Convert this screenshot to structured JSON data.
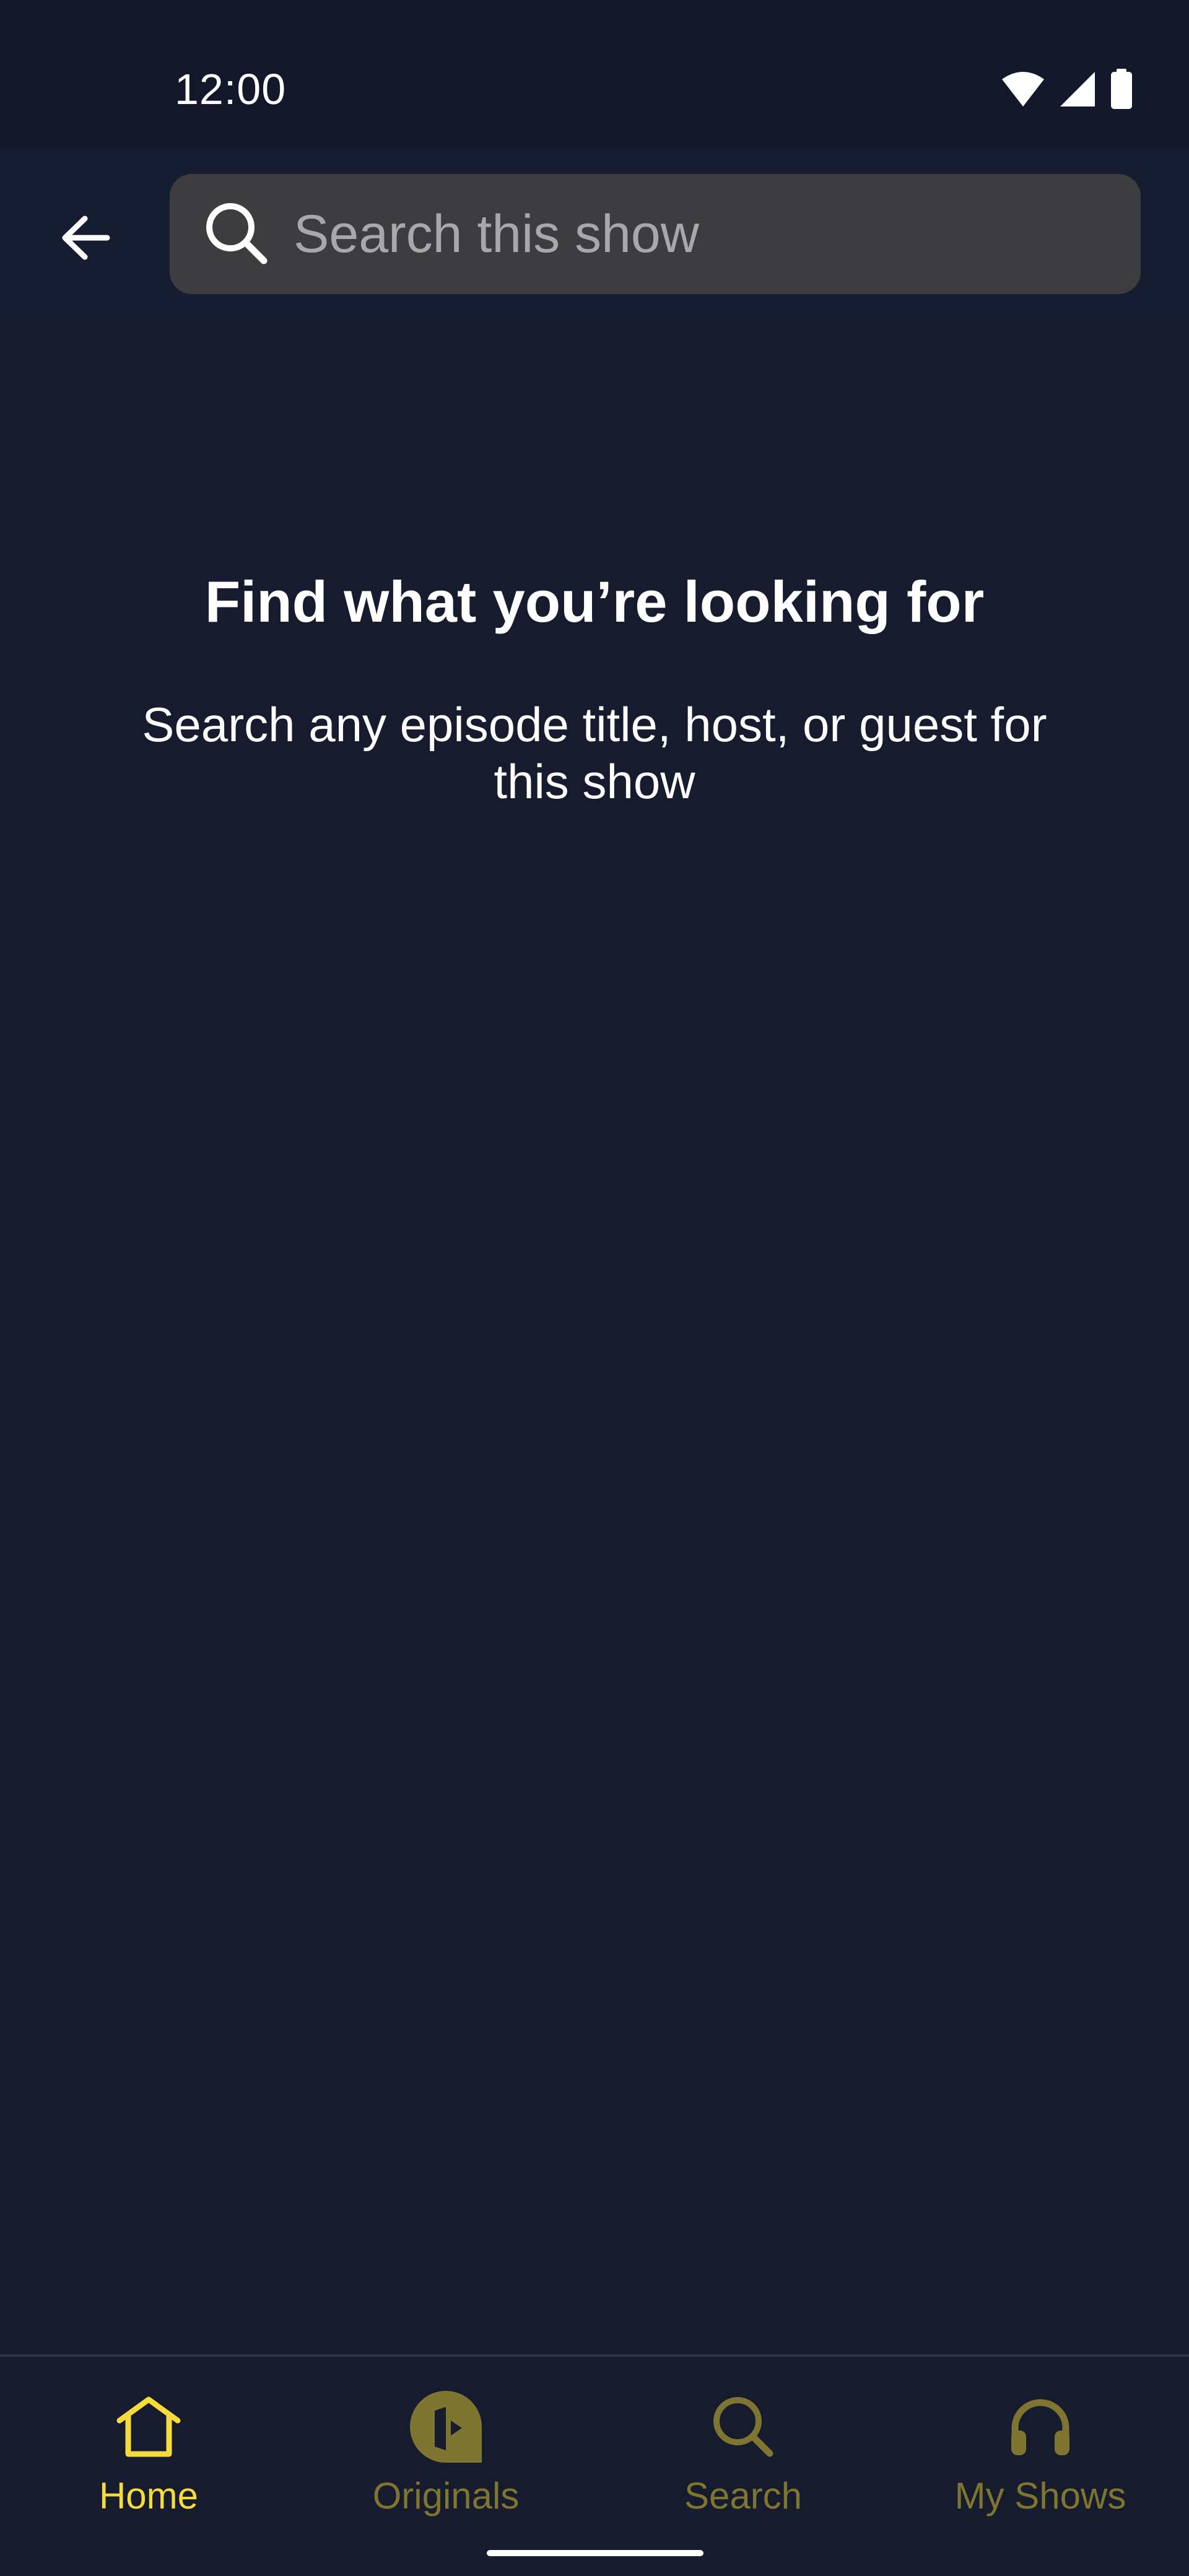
{
  "status_bar": {
    "time": "12:00",
    "icons": [
      "wifi-icon",
      "cellular-signal-icon",
      "battery-icon"
    ]
  },
  "toolbar": {
    "back_icon": "arrow-left-icon",
    "search": {
      "placeholder": "Search this show",
      "value": "",
      "icon": "search-icon"
    }
  },
  "empty_state": {
    "title": "Find what you’re looking for",
    "description": "Search any episode title, host, or guest for this show"
  },
  "bottom_nav": {
    "items": [
      {
        "label": "Home",
        "icon": "home-icon",
        "active": true
      },
      {
        "label": "Originals",
        "icon": "originals-icon",
        "active": false
      },
      {
        "label": "Search",
        "icon": "search-icon",
        "active": false
      },
      {
        "label": "My Shows",
        "icon": "headphones-icon",
        "active": false
      }
    ]
  },
  "colors": {
    "background": "#161c2e",
    "status_bar": "#121829",
    "search_field": "#3d3d3f",
    "nav_active": "#f5dc3c",
    "nav_inactive": "#7d7530"
  }
}
